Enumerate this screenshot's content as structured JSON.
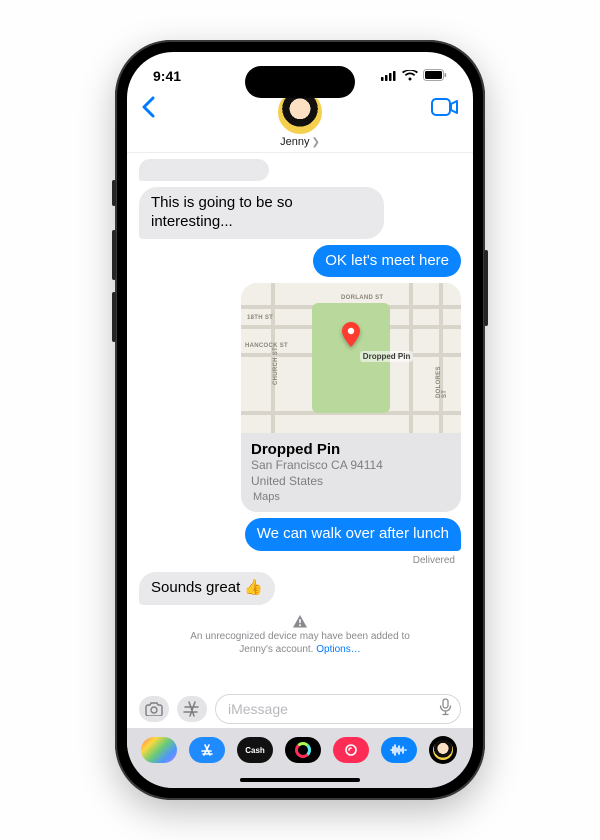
{
  "status": {
    "time": "9:41"
  },
  "contact": {
    "name": "Jenny"
  },
  "messages": {
    "m1": "This is going to be so interesting...",
    "m2": "OK let's meet here",
    "m3": "We can walk over after lunch",
    "m4": "Sounds great 👍"
  },
  "location_card": {
    "title": "Dropped Pin",
    "line1": "San Francisco CA 94114",
    "line2": "United States",
    "source": "Maps",
    "pin_label": "Dropped Pin",
    "streets": {
      "dorland": "DORLAND ST",
      "eighteenth": "18TH ST",
      "hancock": "HANCOCK ST",
      "church": "CHURCH ST",
      "dolores": "DOLORES ST"
    }
  },
  "delivered": "Delivered",
  "warning": {
    "text": "An unrecognized device may have been added to Jenny's account. ",
    "options": "Options…"
  },
  "compose": {
    "placeholder": "iMessage"
  },
  "cash_label": "Cash"
}
